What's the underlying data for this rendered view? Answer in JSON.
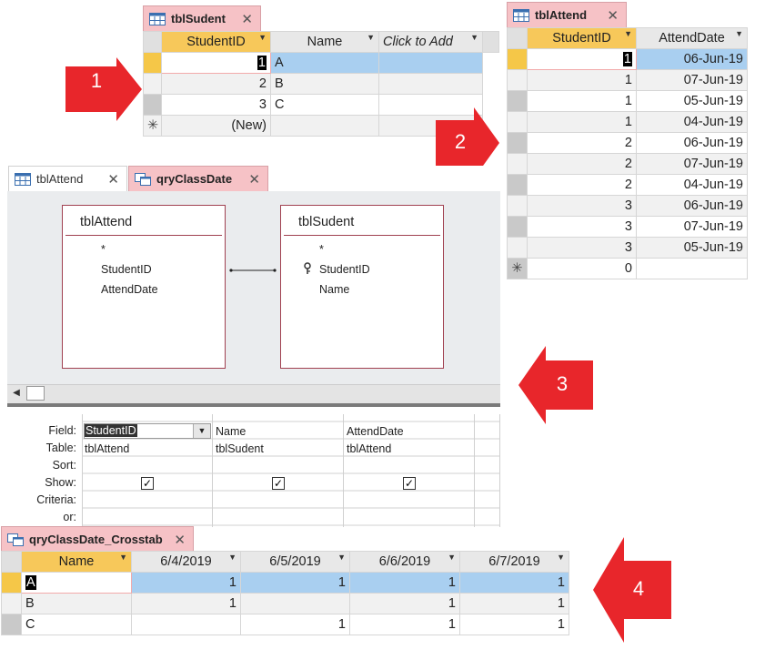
{
  "panel1": {
    "tab_label": "tblSudent",
    "columns": [
      "StudentID",
      "Name",
      "Click to Add"
    ],
    "rows": [
      {
        "id": "1",
        "name": "A"
      },
      {
        "id": "2",
        "name": "B"
      },
      {
        "id": "3",
        "name": "C"
      }
    ],
    "new_row_marker": "✳",
    "new_row_label": "(New)"
  },
  "panel2": {
    "tab_label": "tblAttend",
    "columns": [
      "StudentID",
      "AttendDate"
    ],
    "rows": [
      {
        "id": "1",
        "date": "06-Jun-19"
      },
      {
        "id": "1",
        "date": "07-Jun-19"
      },
      {
        "id": "1",
        "date": "05-Jun-19"
      },
      {
        "id": "1",
        "date": "04-Jun-19"
      },
      {
        "id": "2",
        "date": "06-Jun-19"
      },
      {
        "id": "2",
        "date": "07-Jun-19"
      },
      {
        "id": "2",
        "date": "04-Jun-19"
      },
      {
        "id": "3",
        "date": "06-Jun-19"
      },
      {
        "id": "3",
        "date": "07-Jun-19"
      },
      {
        "id": "3",
        "date": "05-Jun-19"
      }
    ],
    "new_row_marker": "✳",
    "new_row_id": "0"
  },
  "panel3": {
    "tabs": [
      {
        "label": "tblAttend"
      },
      {
        "label": "qryClassDate"
      }
    ],
    "table_attend": {
      "title": "tblAttend",
      "fields": [
        "*",
        "StudentID",
        "AttendDate"
      ]
    },
    "table_sudent": {
      "title": "tblSudent",
      "fields": [
        "*",
        "StudentID",
        "Name"
      ]
    },
    "grid_labels": {
      "field": "Field:",
      "table": "Table:",
      "sort": "Sort:",
      "show": "Show:",
      "criteria": "Criteria:",
      "or": "or:"
    },
    "grid_columns": [
      {
        "field": "StudentID",
        "table": "tblAttend"
      },
      {
        "field": "Name",
        "table": "tblSudent"
      },
      {
        "field": "AttendDate",
        "table": "tblAttend"
      }
    ]
  },
  "panel4": {
    "tab_label": "qryClassDate_Crosstab",
    "columns": [
      "Name",
      "6/4/2019",
      "6/5/2019",
      "6/6/2019",
      "6/7/2019"
    ],
    "rows": [
      {
        "name": "A",
        "c1": "1",
        "c2": "1",
        "c3": "1",
        "c4": "1"
      },
      {
        "name": "B",
        "c1": "1",
        "c2": "",
        "c3": "1",
        "c4": "1"
      },
      {
        "name": "C",
        "c1": "",
        "c2": "1",
        "c3": "1",
        "c4": "1"
      }
    ]
  },
  "callouts": {
    "one": "1",
    "two": "2",
    "three": "3",
    "four": "4"
  },
  "colors": {
    "active_tab": "#f6c2c6",
    "selected_header": "#f7c85a",
    "highlight_row": "#a9cff0",
    "callout": "#e8262b"
  }
}
